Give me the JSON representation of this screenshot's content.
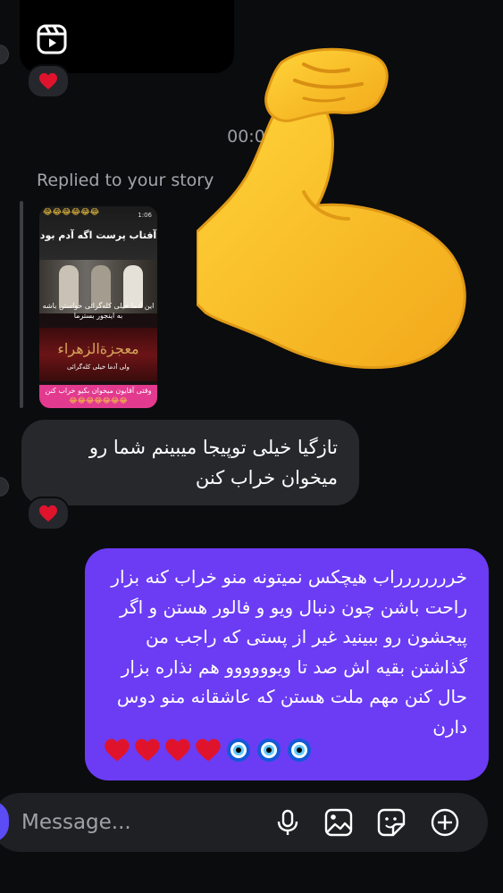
{
  "conversation": {
    "reel_icon": "reels-icon",
    "reaction_emoji": "red-heart",
    "timestamp": "00:06",
    "replied_label": "Replied to your story",
    "story_preview": {
      "emoji_row_top": "😂😂😂😂😂😂",
      "time": "1:06",
      "title": "آفتاب پرست اگه آدم بود",
      "overlay_text": "این آدما خیلی کله‌گرائی خواستن باشه به اینجور بسترما",
      "banner_text": "معجزةالزهراء",
      "caption": "ولی آدما خیلی کله‌گرائی",
      "bottom_text": "وقتی آقایون میخوان بکیو خراب کنن",
      "emoji_row_bottom": "😂😂😂😂😂😂😂"
    },
    "sticker": "flexed-biceps",
    "incoming_message": {
      "text": "تازگیا خیلی توپیجا میبینم شما رو میخوان خراب کنن"
    },
    "outgoing_message": {
      "text": "خررررررراب هیچکس نمیتونه منو خراب کنه بزار راحت باشن چون دنبال ویو و فالور هستن و اگر پیجشون رو ببینید غیر از پستی که راجب من گذاشتن بقیه اش صد تا ویوووووو هم نذاره بزار حال کنن مهم ملت هستن که عاشقانه منو دوس دارن",
      "emojis": [
        "nazar-amulet",
        "nazar-amulet",
        "nazar-amulet",
        "red-heart",
        "red-heart",
        "red-heart",
        "red-heart"
      ]
    }
  },
  "composer": {
    "placeholder": "Message...",
    "icons": [
      "microphone-icon",
      "gallery-icon",
      "sticker-icon",
      "add-icon"
    ]
  },
  "colors": {
    "background": "#0b0c0e",
    "incoming_bubble": "#27282c",
    "outgoing_bubble": "#6b3cf4",
    "composer": "#1f2024",
    "camera_button": "#5b4cf5",
    "heart": "#e0132d"
  }
}
